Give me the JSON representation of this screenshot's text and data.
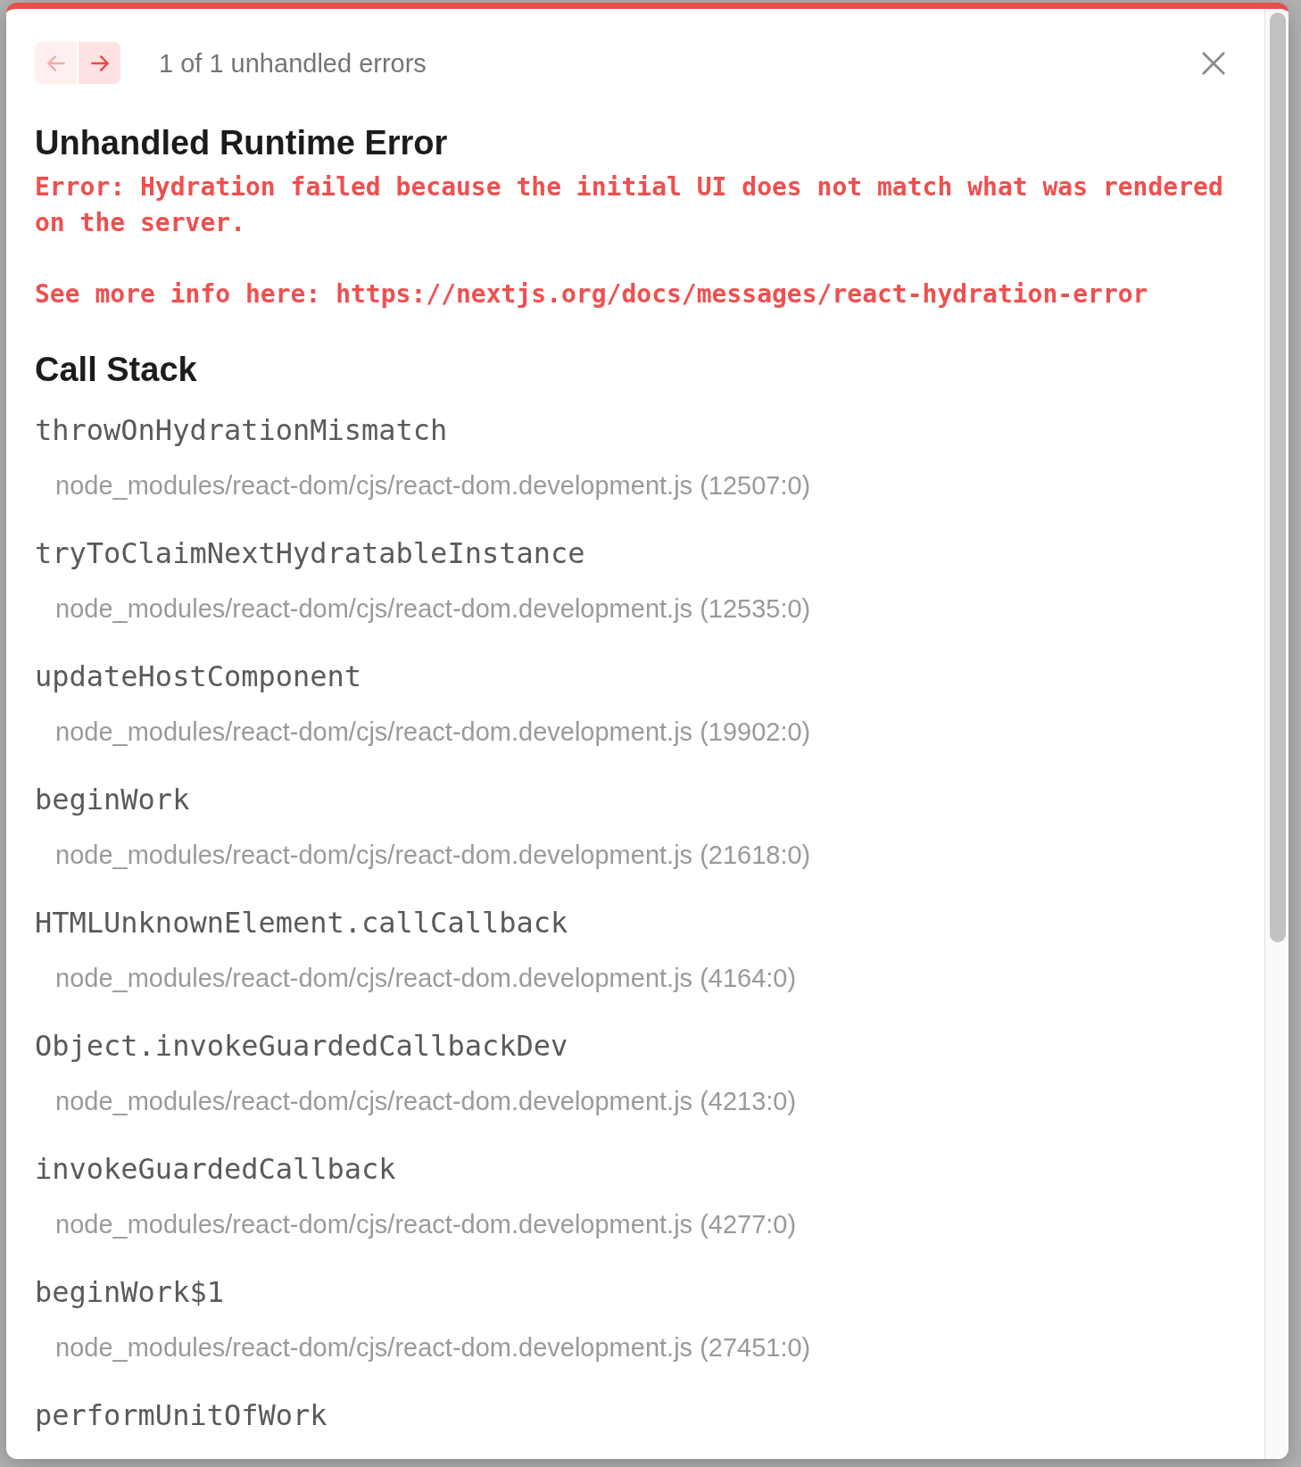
{
  "dialog": {
    "nav_buttons": [
      {
        "kind": "previous",
        "disabled": true
      },
      {
        "kind": "next",
        "disabled": false
      }
    ],
    "counter": "1 of 1 unhandled errors",
    "title": "Unhandled Runtime Error",
    "message": "Error: Hydration failed because the initial UI does not match what was rendered on the server.",
    "more_info": "See more info here: https://nextjs.org/docs/messages/react-hydration-error"
  },
  "call_stack": {
    "title": "Call Stack",
    "frames": [
      {
        "function": "throwOnHydrationMismatch",
        "location": "node_modules/react-dom/cjs/react-dom.development.js (12507:0)"
      },
      {
        "function": "tryToClaimNextHydratableInstance",
        "location": "node_modules/react-dom/cjs/react-dom.development.js (12535:0)"
      },
      {
        "function": "updateHostComponent",
        "location": "node_modules/react-dom/cjs/react-dom.development.js (19902:0)"
      },
      {
        "function": "beginWork",
        "location": "node_modules/react-dom/cjs/react-dom.development.js (21618:0)"
      },
      {
        "function": "HTMLUnknownElement.callCallback",
        "location": "node_modules/react-dom/cjs/react-dom.development.js (4164:0)"
      },
      {
        "function": "Object.invokeGuardedCallbackDev",
        "location": "node_modules/react-dom/cjs/react-dom.development.js (4213:0)"
      },
      {
        "function": "invokeGuardedCallback",
        "location": "node_modules/react-dom/cjs/react-dom.development.js (4277:0)"
      },
      {
        "function": "beginWork$1",
        "location": "node_modules/react-dom/cjs/react-dom.development.js (27451:0)"
      },
      {
        "function": "performUnitOfWork"
      }
    ]
  }
}
